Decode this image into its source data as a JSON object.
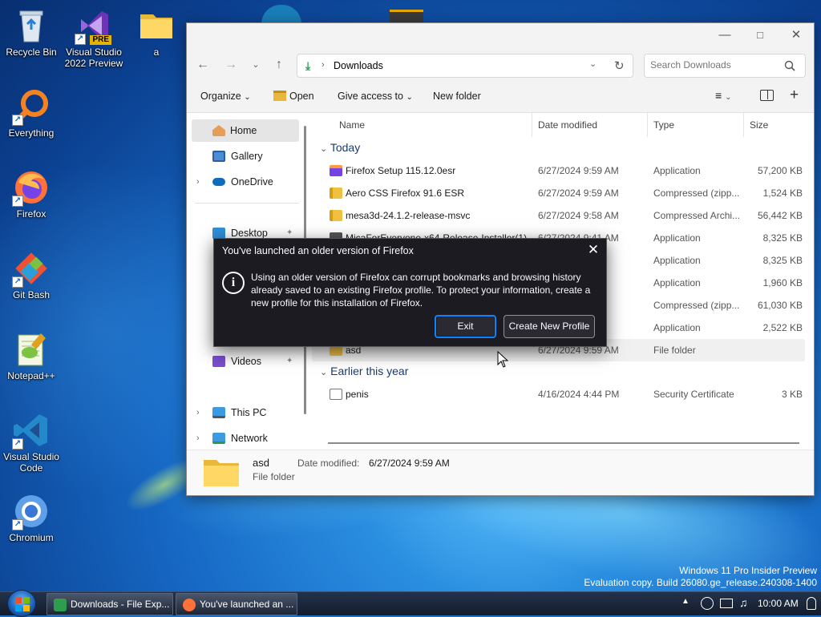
{
  "desktop": {
    "icons": [
      {
        "label": "Recycle Bin",
        "icon": "recycle-bin-icon"
      },
      {
        "label": "Visual Studio 2022 Preview",
        "badge": "PRE",
        "icon": "visual-studio-preview-icon"
      },
      {
        "label": "a",
        "icon": "folder-icon"
      },
      {
        "label": "Everything",
        "icon": "everything-search-icon"
      },
      {
        "label": "Firefox",
        "icon": "firefox-icon"
      },
      {
        "label": "Git Bash",
        "icon": "git-bash-icon"
      },
      {
        "label": "Notepad++",
        "icon": "notepad-plus-plus-icon"
      },
      {
        "label": "Visual Studio Code",
        "icon": "vscode-icon"
      },
      {
        "label": "Chromium",
        "icon": "chromium-icon"
      }
    ],
    "watermark": {
      "line1": "Windows 11 Pro Insider Preview",
      "line2": "Evaluation copy. Build 26080.ge_release.240308-1400"
    }
  },
  "explorer": {
    "address": {
      "crumb": "Downloads"
    },
    "search": {
      "placeholder": "Search Downloads"
    },
    "toolbar": {
      "organize": "Organize",
      "open": "Open",
      "give_access": "Give access to",
      "new_folder": "New folder"
    },
    "nav": [
      {
        "label": "Home",
        "icon": "home-icon"
      },
      {
        "label": "Gallery",
        "icon": "gallery-icon"
      },
      {
        "label": "OneDrive",
        "icon": "onedrive-icon"
      },
      {
        "label": "Desktop",
        "icon": "desktop-icon"
      },
      {
        "label": "Videos",
        "icon": "videos-icon"
      },
      {
        "label": "This PC",
        "icon": "this-pc-icon"
      },
      {
        "label": "Network",
        "icon": "network-icon"
      }
    ],
    "columns": {
      "name": "Name",
      "date": "Date modified",
      "type": "Type",
      "size": "Size"
    },
    "groups": {
      "today": "Today",
      "earlier": "Earlier this year"
    },
    "files": [
      {
        "name": "Firefox Setup 115.12.0esr",
        "date": "6/27/2024 9:59 AM",
        "type": "Application",
        "size": "57,200 KB",
        "icon": "installer-icon"
      },
      {
        "name": "Aero CSS Firefox 91.6 ESR",
        "date": "6/27/2024 9:59 AM",
        "type": "Compressed (zipp...",
        "size": "1,524 KB",
        "icon": "zip-folder-icon"
      },
      {
        "name": "mesa3d-24.1.2-release-msvc",
        "date": "6/27/2024 9:58 AM",
        "type": "Compressed Archi...",
        "size": "56,442 KB",
        "icon": "archive-icon"
      },
      {
        "name": "MicaForEveryone-x64-Release-Installer(1)",
        "date": "6/27/2024 9:41 AM",
        "type": "Application",
        "size": "8,325 KB",
        "icon": "installer-icon"
      },
      {
        "name": "",
        "date": "",
        "type": "Application",
        "size": "8,325 KB",
        "icon": "installer-icon"
      },
      {
        "name": "",
        "date": "",
        "type": "Application",
        "size": "1,960 KB",
        "icon": "installer-icon"
      },
      {
        "name": "",
        "date": "",
        "type": "Compressed (zipp...",
        "size": "61,030 KB",
        "icon": "zip-folder-icon"
      },
      {
        "name": "",
        "date": "",
        "type": "Application",
        "size": "2,522 KB",
        "icon": "installer-icon"
      },
      {
        "name": "asd",
        "date": "6/27/2024 9:59 AM",
        "type": "File folder",
        "size": "",
        "icon": "folder-icon"
      }
    ],
    "earlier_files": [
      {
        "name": "penis",
        "date": "4/16/2024 4:44 PM",
        "type": "Security Certificate",
        "size": "3 KB",
        "icon": "certificate-icon"
      }
    ],
    "details": {
      "name": "asd",
      "type": "File folder",
      "date_label": "Date modified:",
      "date_value": "6/27/2024 9:59 AM"
    }
  },
  "dialog": {
    "title": "You've launched an older version of Firefox",
    "message": "Using an older version of Firefox can corrupt bookmarks and browsing history already saved to an existing Firefox profile. To protect your information, create a new profile for this installation of Firefox.",
    "exit": "Exit",
    "create_profile": "Create New Profile"
  },
  "taskbar": {
    "buttons": [
      {
        "label": "Downloads - File Exp...",
        "icon": "file-explorer-icon"
      },
      {
        "label": "You've launched an ...",
        "icon": "firefox-icon"
      }
    ],
    "time": "10:00 AM"
  },
  "colors": {
    "accent": "#0067c0",
    "dialog_bg": "#1c1b22",
    "dialog_button_focus": "#0a84ff"
  }
}
